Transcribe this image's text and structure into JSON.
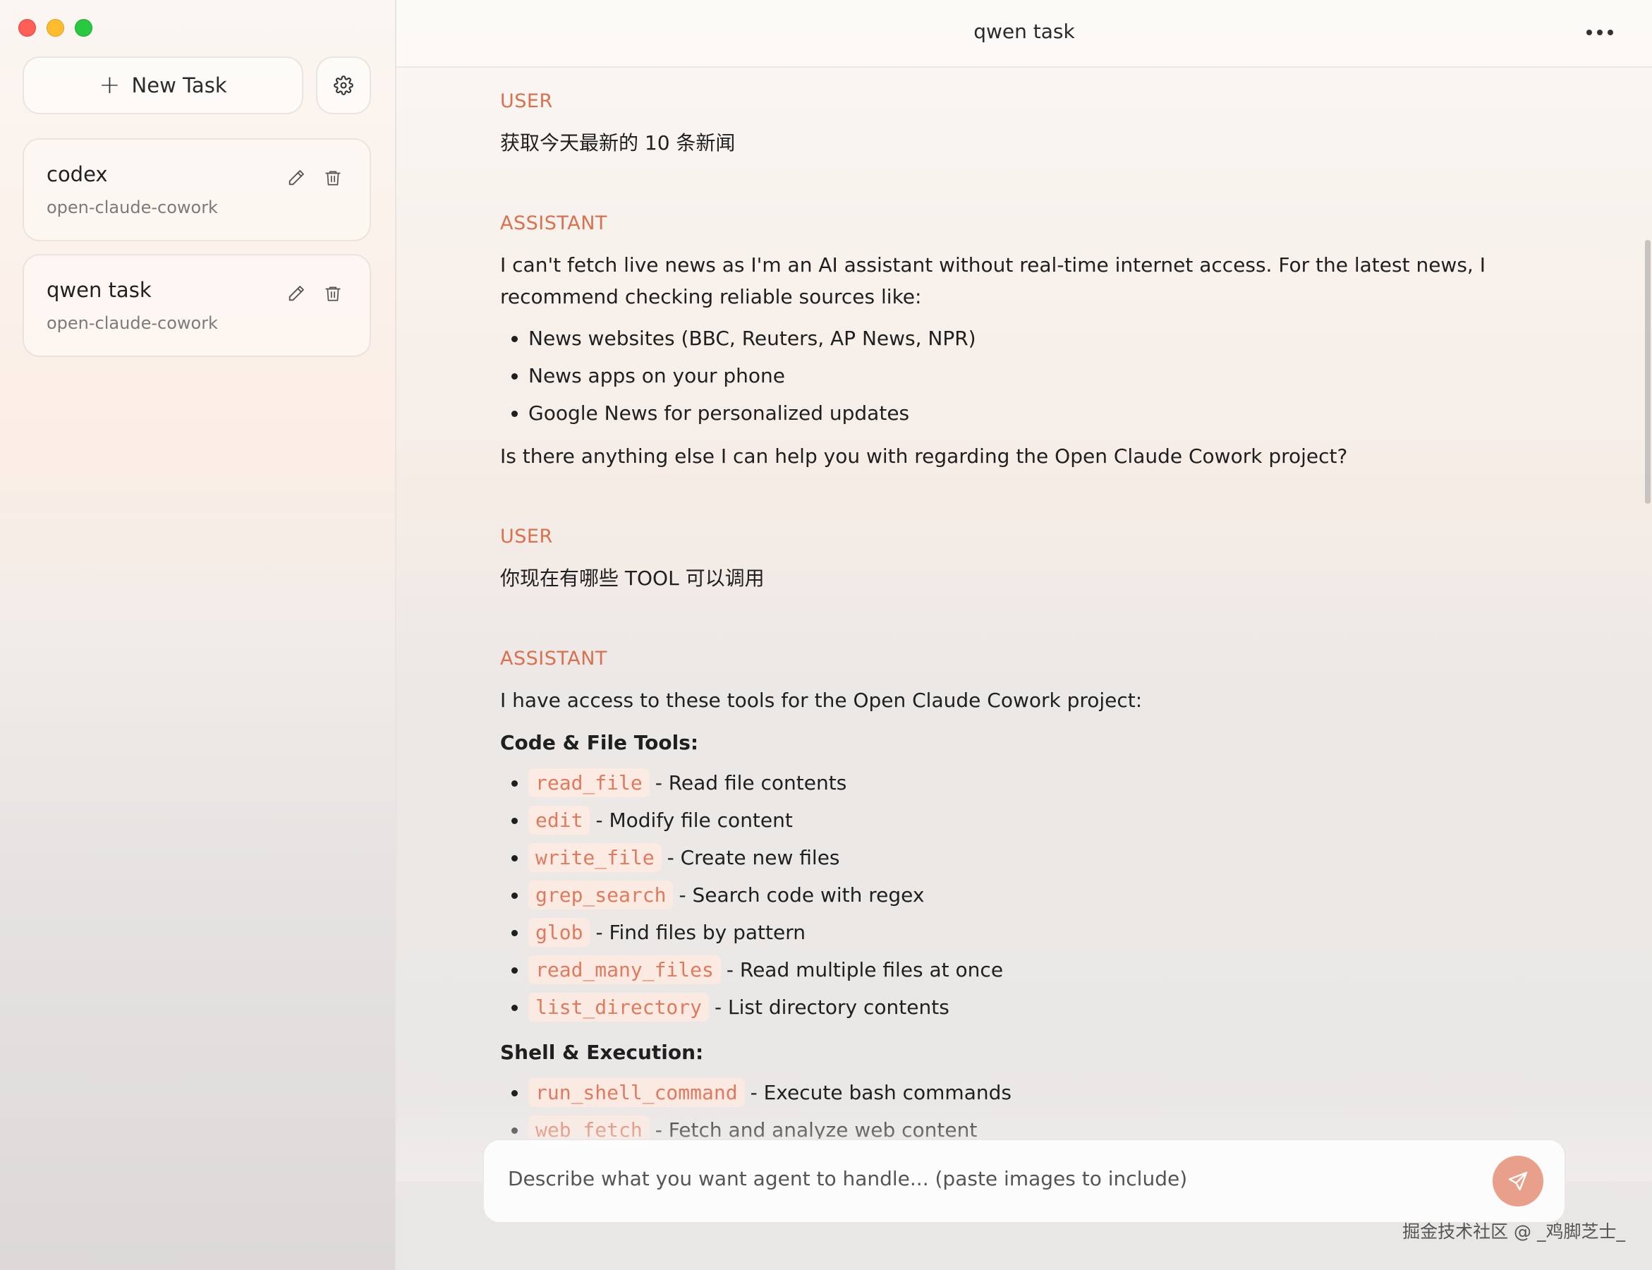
{
  "sidebar": {
    "new_task_label": "New Task",
    "tasks": [
      {
        "title": "codex",
        "subtitle": "open-claude-cowork"
      },
      {
        "title": "qwen task",
        "subtitle": "open-claude-cowork"
      }
    ]
  },
  "header": {
    "title": "qwen task"
  },
  "conversation": {
    "m1": {
      "role": "USER",
      "text": "获取今天最新的 10 条新闻"
    },
    "m2": {
      "role": "ASSISTANT",
      "intro": "I can't fetch live news as I'm an AI assistant without real-time internet access. For the latest news, I recommend checking reliable sources like:",
      "bullets": [
        "News websites (BBC, Reuters, AP News, NPR)",
        "News apps on your phone",
        "Google News for personalized updates"
      ],
      "outro": "Is there anything else I can help you with regarding the Open Claude Cowork project?"
    },
    "m3": {
      "role": "USER",
      "text": "你现在有哪些 TOOL 可以调用"
    },
    "m4": {
      "role": "ASSISTANT",
      "intro": "I have access to these tools for the Open Claude Cowork project:",
      "section1": "Code & File Tools:",
      "tools1": [
        {
          "name": "read_file",
          "desc": "- Read file contents"
        },
        {
          "name": "edit",
          "desc": "- Modify file content"
        },
        {
          "name": "write_file",
          "desc": "- Create new files"
        },
        {
          "name": "grep_search",
          "desc": "- Search code with regex"
        },
        {
          "name": "glob",
          "desc": "- Find files by pattern"
        },
        {
          "name": "read_many_files",
          "desc": "- Read multiple files at once"
        },
        {
          "name": "list_directory",
          "desc": "- List directory contents"
        }
      ],
      "section2": "Shell & Execution:",
      "tools2": [
        {
          "name": "run_shell_command",
          "desc": "- Execute bash commands"
        },
        {
          "name": "web_fetch",
          "desc": "- Fetch and analyze web content"
        }
      ]
    }
  },
  "composer": {
    "placeholder": "Describe what you want agent to handle... (paste images to include)"
  },
  "watermark": "掘金技术社区 @ _鸡脚芝士_",
  "colors": {
    "accent": "#d9704e",
    "code": "#e07a5f",
    "send": "#e8a08b"
  },
  "icons": [
    "plus-icon",
    "gear-icon",
    "pencil-icon",
    "trash-icon",
    "more-icon",
    "send-icon"
  ]
}
